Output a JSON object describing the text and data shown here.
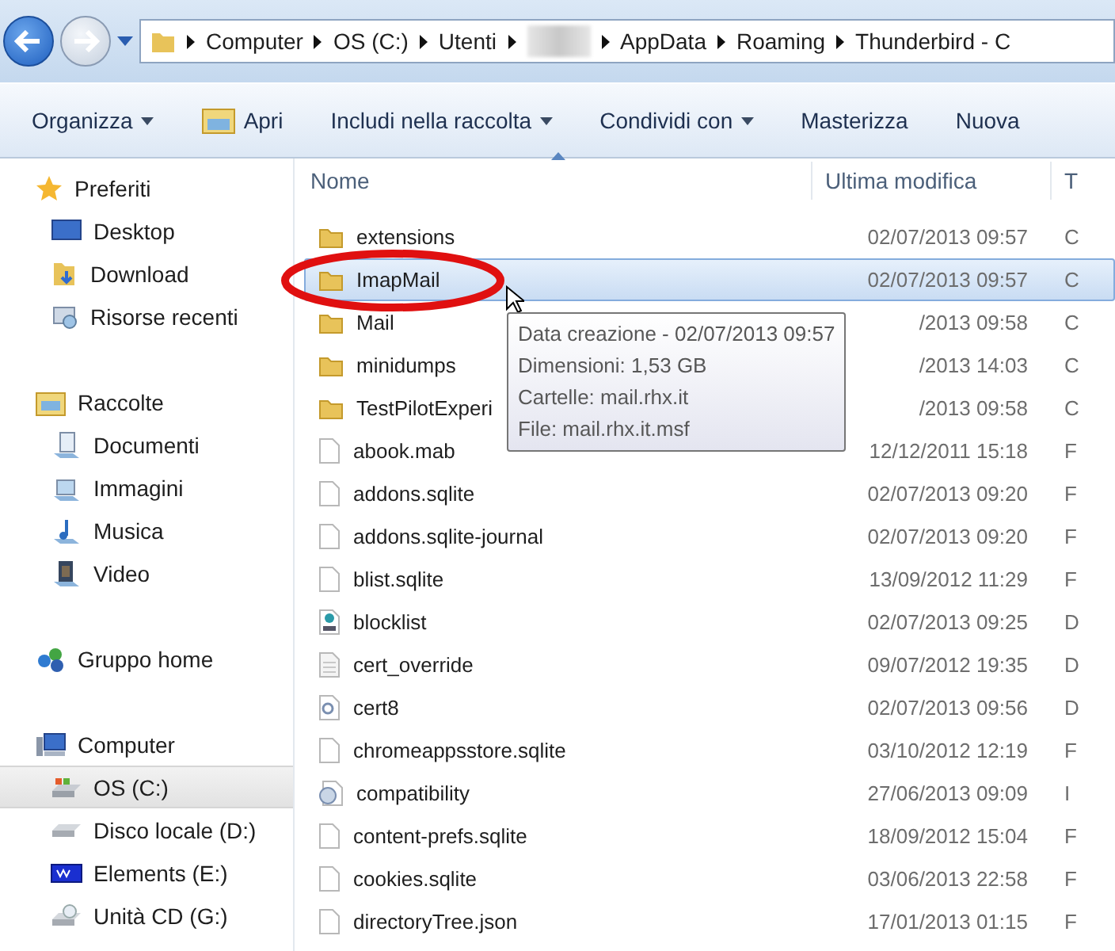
{
  "breadcrumb": [
    {
      "label": "Computer",
      "kind": "text"
    },
    {
      "label": "OS (C:)",
      "kind": "text"
    },
    {
      "label": "Utenti",
      "kind": "text"
    },
    {
      "kind": "redacted"
    },
    {
      "label": "AppData",
      "kind": "text"
    },
    {
      "label": "Roaming",
      "kind": "text"
    },
    {
      "label": "Thunderbird - C",
      "kind": "text"
    }
  ],
  "toolbar": [
    {
      "label": "Organizza",
      "dropdown": true
    },
    {
      "label": "Apri",
      "dropdown": false
    },
    {
      "label": "Includi nella raccolta",
      "dropdown": true
    },
    {
      "label": "Condividi con",
      "dropdown": true
    },
    {
      "label": "Masterizza",
      "dropdown": false
    },
    {
      "label": "Nuova",
      "dropdown": false
    }
  ],
  "sidebar": [
    {
      "label": "Preferiti",
      "selected": false,
      "children": [
        {
          "label": "Desktop",
          "selected": false
        },
        {
          "label": "Download",
          "selected": false
        },
        {
          "label": "Risorse recenti",
          "selected": false
        }
      ]
    },
    {
      "label": "Raccolte",
      "selected": false,
      "children": [
        {
          "label": "Documenti",
          "selected": false
        },
        {
          "label": "Immagini",
          "selected": false
        },
        {
          "label": "Musica",
          "selected": false
        },
        {
          "label": "Video",
          "selected": false
        }
      ]
    },
    {
      "label": "Gruppo home",
      "selected": false
    },
    {
      "label": "Computer",
      "selected": false,
      "children": [
        {
          "label": "OS (C:)",
          "selected": true
        },
        {
          "label": "Disco locale (D:)",
          "selected": false
        },
        {
          "label": "Elements (E:)",
          "selected": false
        },
        {
          "label": "Unità CD (G:)",
          "selected": false
        }
      ]
    }
  ],
  "table": {
    "columns": [
      "Nome",
      "Ultima modifica",
      "T"
    ],
    "rows": [
      {
        "name": "extensions",
        "date": "02/07/2013 09:57",
        "column_3": "C",
        "kind": "folder",
        "selected": false
      },
      {
        "name": "ImapMail",
        "date": "02/07/2013 09:57",
        "column_3": "C",
        "kind": "folder",
        "selected": true
      },
      {
        "name": "Mail",
        "date": "/2013 09:58",
        "column_3": "C",
        "kind": "folder",
        "selected": false
      },
      {
        "name": "minidumps",
        "date": "/2013 14:03",
        "column_3": "C",
        "kind": "folder",
        "selected": false
      },
      {
        "name": "TestPilotExperi",
        "date": "/2013 09:58",
        "column_3": "C",
        "kind": "folder",
        "selected": false
      },
      {
        "name": "abook.mab",
        "date": "12/12/2011 15:18",
        "column_3": "F",
        "kind": "file",
        "selected": false
      },
      {
        "name": "addons.sqlite",
        "date": "02/07/2013 09:20",
        "column_3": "F",
        "kind": "file",
        "selected": false
      },
      {
        "name": "addons.sqlite-journal",
        "date": "02/07/2013 09:20",
        "column_3": "F",
        "kind": "file",
        "selected": false
      },
      {
        "name": "blist.sqlite",
        "date": "13/09/2012 11:29",
        "column_3": "F",
        "kind": "file",
        "selected": false
      },
      {
        "name": "blocklist",
        "date": "02/07/2013 09:25",
        "column_3": "D",
        "kind": "config",
        "selected": false
      },
      {
        "name": "cert_override",
        "date": "09/07/2012 19:35",
        "column_3": "D",
        "kind": "text",
        "selected": false
      },
      {
        "name": "cert8",
        "date": "02/07/2013 09:56",
        "column_3": "D",
        "kind": "cert",
        "selected": false
      },
      {
        "name": "chromeappsstore.sqlite",
        "date": "03/10/2012 12:19",
        "column_3": "F",
        "kind": "file",
        "selected": false
      },
      {
        "name": "compatibility",
        "date": "27/06/2013 09:09",
        "column_3": "I",
        "kind": "settings",
        "selected": false
      },
      {
        "name": "content-prefs.sqlite",
        "date": "18/09/2012 15:04",
        "column_3": "F",
        "kind": "file",
        "selected": false
      },
      {
        "name": "cookies.sqlite",
        "date": "03/06/2013 22:58",
        "column_3": "F",
        "kind": "file",
        "selected": false
      },
      {
        "name": "directoryTree.json",
        "date": "17/01/2013 01:15",
        "column_3": "F",
        "kind": "file",
        "selected": false
      }
    ]
  },
  "tooltip": [
    "Data creazione - 02/07/2013 09:57",
    "Dimensioni: 1,53 GB",
    "Cartelle: mail.rhx.it",
    "File: mail.rhx.it.msf"
  ]
}
